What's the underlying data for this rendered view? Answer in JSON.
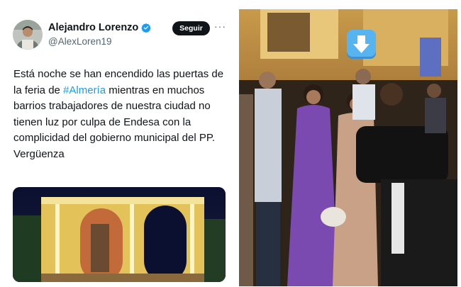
{
  "tweet": {
    "display_name": "Alejandro Lorenzo",
    "handle": "@AlexLoren19",
    "follow_label": "Seguir",
    "more_label": "···",
    "text_before": "Está noche se han encendido las puertas de la feria de ",
    "hashtag": "#Almería",
    "text_after": " mientras en muchos barrios trabajadores de nuestra ciudad no tienen luz por culpa de Endesa con la complicidad del gobierno municipal del PP.\nVergüenza",
    "icons": [
      "verified-badge-icon",
      "more-options-icon"
    ],
    "colors": {
      "verified": "#1d9bf0",
      "hashtag": "#1d9bf0",
      "follow_bg": "#0f1419",
      "handle": "#536471"
    }
  },
  "photo": {
    "overlay_icon": "down-arrow-emoji-icon",
    "overlay_color": "#56b5f0"
  }
}
